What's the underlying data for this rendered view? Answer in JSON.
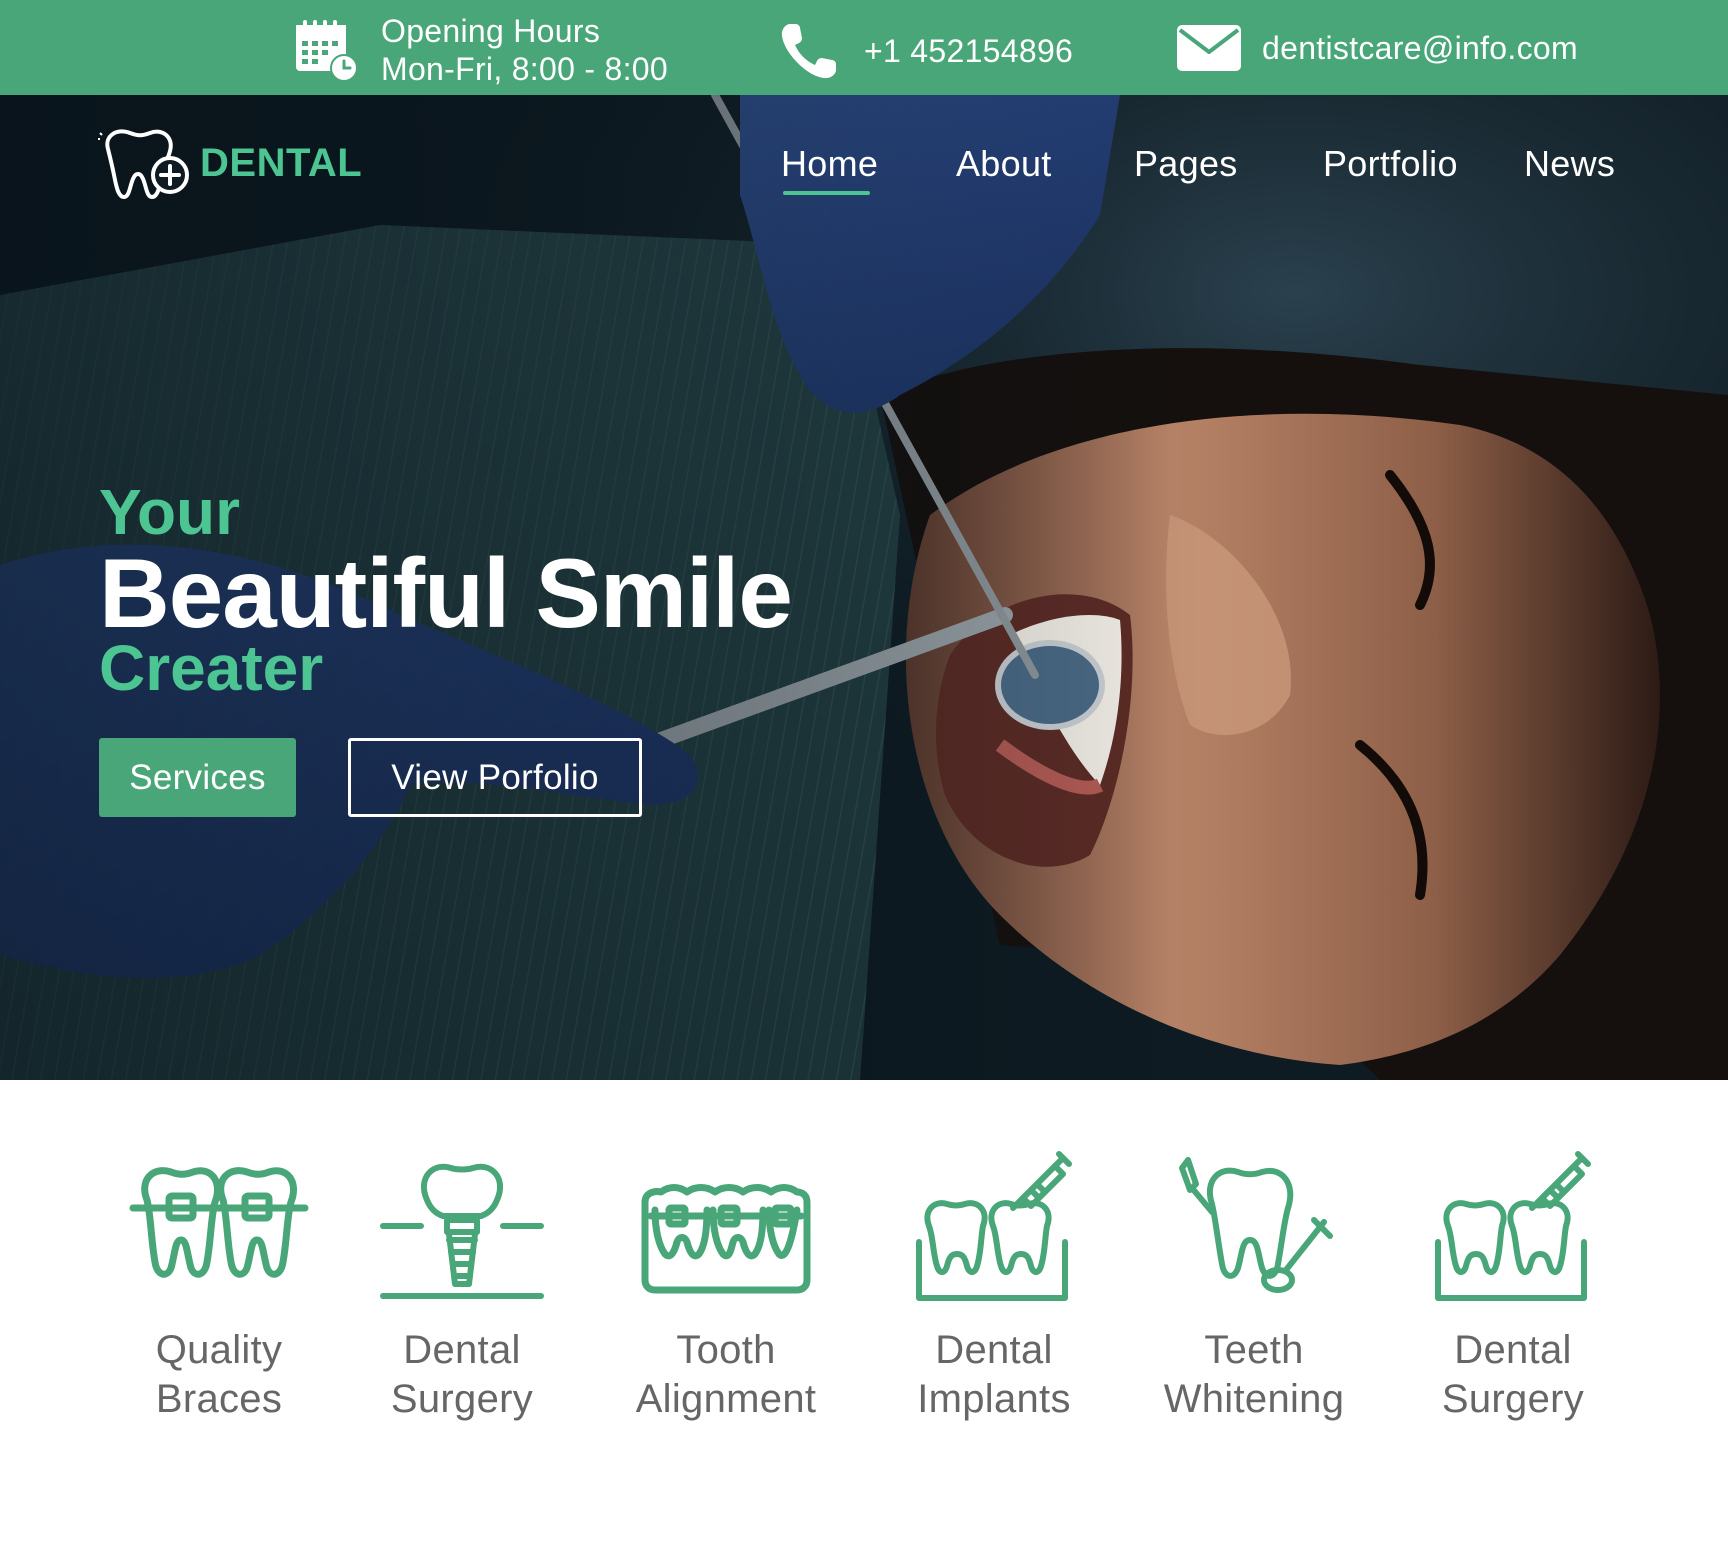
{
  "topbar": {
    "hours_title": "Opening Hours",
    "hours_value": "Mon-Fri, 8:00 - 8:00",
    "phone": "+1 452154896",
    "email": "dentistcare@info.com",
    "icons": [
      "calendar-clock-icon",
      "phone-icon",
      "mail-icon"
    ]
  },
  "brand": {
    "name": "DENTAL",
    "logo_icon": "tooth-plus-icon",
    "accent_color": "#48a679",
    "accent_light": "#4cc592"
  },
  "nav": {
    "items": [
      "Home",
      "About",
      "Pages",
      "Portfolio",
      "News"
    ],
    "active": "Home"
  },
  "hero": {
    "line1": "Your",
    "line2": "Beautiful Smile",
    "line3": "Creater",
    "primary_button": "Services",
    "secondary_button": "View Porfolio"
  },
  "services": [
    {
      "line1": "Quality",
      "line2": "Braces",
      "icon": "braces-icon"
    },
    {
      "line1": "Dental",
      "line2": "Surgery",
      "icon": "implant-icon"
    },
    {
      "line1": "Tooth",
      "line2": "Alignment",
      "icon": "aligner-icon"
    },
    {
      "line1": "Dental",
      "line2": "Implants",
      "icon": "teeth-syringe-icon"
    },
    {
      "line1": "Teeth",
      "line2": "Whitening",
      "icon": "tooth-tools-icon"
    },
    {
      "line1": "Dental",
      "line2": "Surgery",
      "icon": "teeth-syringe-icon"
    }
  ]
}
